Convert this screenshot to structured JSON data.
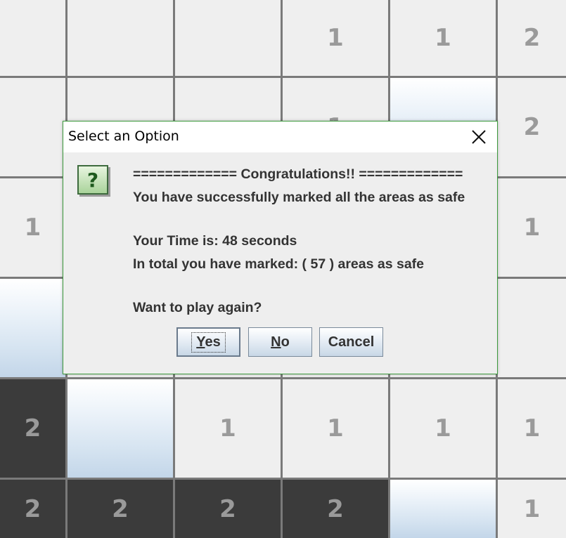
{
  "board": {
    "rows": [
      [
        {
          "state": "revealed",
          "label": ""
        },
        {
          "state": "revealed",
          "label": ""
        },
        {
          "state": "revealed",
          "label": ""
        },
        {
          "state": "revealed",
          "label": "1"
        },
        {
          "state": "revealed",
          "label": "1"
        },
        {
          "state": "revealed",
          "label": "2"
        }
      ],
      [
        {
          "state": "revealed",
          "label": ""
        },
        {
          "state": "revealed",
          "label": ""
        },
        {
          "state": "revealed",
          "label": ""
        },
        {
          "state": "revealed",
          "label": "1"
        },
        {
          "state": "covered",
          "label": ""
        },
        {
          "state": "revealed",
          "label": "2"
        }
      ],
      [
        {
          "state": "revealed",
          "label": "1"
        },
        {
          "state": "revealed",
          "label": ""
        },
        {
          "state": "revealed",
          "label": ""
        },
        {
          "state": "revealed",
          "label": ""
        },
        {
          "state": "revealed",
          "label": ""
        },
        {
          "state": "revealed",
          "label": "1"
        }
      ],
      [
        {
          "state": "covered",
          "label": ""
        },
        {
          "state": "revealed",
          "label": ""
        },
        {
          "state": "revealed",
          "label": ""
        },
        {
          "state": "revealed",
          "label": ""
        },
        {
          "state": "revealed",
          "label": ""
        },
        {
          "state": "revealed",
          "label": ""
        }
      ],
      [
        {
          "state": "dark",
          "label": "2"
        },
        {
          "state": "covered",
          "label": ""
        },
        {
          "state": "revealed",
          "label": "1"
        },
        {
          "state": "revealed",
          "label": "1"
        },
        {
          "state": "revealed",
          "label": "1"
        },
        {
          "state": "revealed",
          "label": "1"
        }
      ],
      [
        {
          "state": "dark",
          "label": "2"
        },
        {
          "state": "dark",
          "label": "2"
        },
        {
          "state": "dark",
          "label": "2"
        },
        {
          "state": "dark",
          "label": "2"
        },
        {
          "state": "covered",
          "label": ""
        },
        {
          "state": "revealed",
          "label": "1"
        }
      ]
    ]
  },
  "dialog": {
    "title": "Select an Option",
    "icon": "question-icon",
    "lines": {
      "congrats": "============= Congratulations!! =============",
      "success": "You have successfully marked all the areas as safe",
      "time": "Your Time is:  48 seconds",
      "total": "In total you have marked: ( 57 ) areas as safe",
      "prompt": "Want to play again?"
    },
    "buttons": {
      "yes": {
        "mnemonic": "Y",
        "rest": "es"
      },
      "no": {
        "mnemonic": "N",
        "rest": "o"
      },
      "cancel": "Cancel"
    }
  },
  "colors": {
    "dialog_border": "#3c9a3c",
    "revealed_cell": "#efefef",
    "dark_cell": "#3b3b3b",
    "grid_line": "#7a7a7a"
  }
}
